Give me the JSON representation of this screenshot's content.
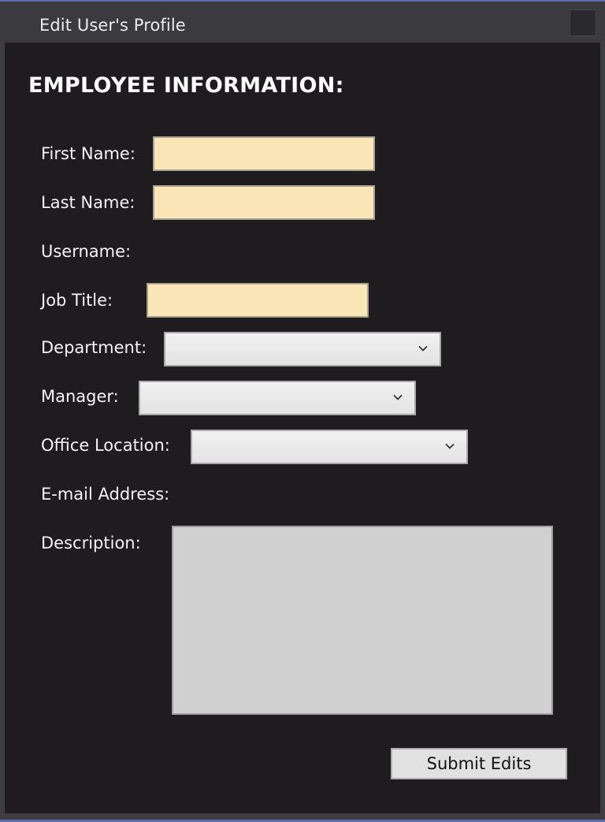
{
  "window": {
    "title": "Edit User's Profile"
  },
  "form": {
    "heading": "EMPLOYEE INFORMATION:",
    "first_name": {
      "label": "First Name:",
      "value": ""
    },
    "last_name": {
      "label": "Last Name:",
      "value": ""
    },
    "username": {
      "label": "Username:",
      "value": ""
    },
    "job_title": {
      "label": "Job Title:",
      "value": ""
    },
    "department": {
      "label": "Department:",
      "value": ""
    },
    "manager": {
      "label": "Manager:",
      "value": ""
    },
    "office_location": {
      "label": "Office Location:",
      "value": ""
    },
    "email": {
      "label": "E-mail Address:",
      "value": ""
    },
    "description": {
      "label": "Description:",
      "value": ""
    },
    "submit_label": "Submit Edits"
  },
  "icons": {
    "dropdown": "chevron-down-icon",
    "window_button": "window-control-icon"
  },
  "colors": {
    "background": "#1e1c1e",
    "titlebar": "#3a3a3f",
    "text_input": "#fbe6b8",
    "combo": "#e8e8e8",
    "description_box": "#d0d0d0",
    "accent_border": "#5a6fa8"
  }
}
